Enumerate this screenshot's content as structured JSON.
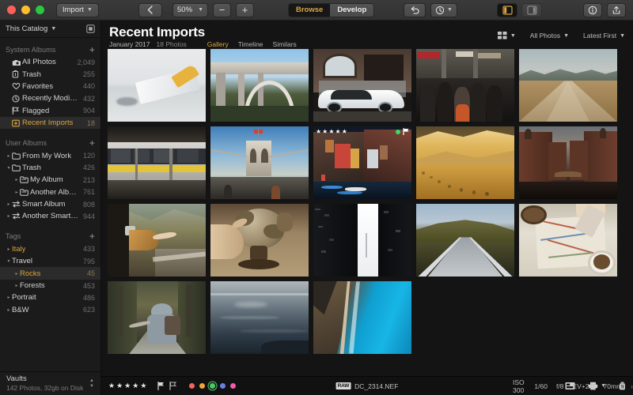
{
  "titlebar": {
    "import_label": "Import",
    "zoom_value": "50%",
    "zoom_out": "−",
    "zoom_in": "+",
    "mode_tabs": [
      {
        "label": "Browse",
        "active": true
      },
      {
        "label": "Develop",
        "active": false
      }
    ],
    "icons": {
      "back": "chevron-left-icon",
      "undo": "undo-arrow-icon",
      "history": "clock-history-icon",
      "left_panel": "left-panel-toggle-icon",
      "right_panel": "right-panel-toggle-icon",
      "info": "info-circle-icon",
      "share": "share-upload-icon"
    }
  },
  "sidebar": {
    "catalog": {
      "label": "This Catalog",
      "icon": "catalog-square-icon"
    },
    "sections": [
      {
        "title": "System Albums",
        "add": "+",
        "items": [
          {
            "label": "All Photos",
            "count": "2,049",
            "icon": "photos-stack-icon",
            "indent": 0,
            "selected": false,
            "accent": false,
            "twisty": ""
          },
          {
            "label": "Trash",
            "count": "255",
            "icon": "trash-icon",
            "indent": 0,
            "selected": false,
            "accent": false,
            "twisty": ""
          },
          {
            "label": "Favorites",
            "count": "440",
            "icon": "heart-icon",
            "indent": 0,
            "selected": false,
            "accent": false,
            "twisty": ""
          },
          {
            "label": "Recently Modified",
            "count": "432",
            "icon": "clock-icon",
            "indent": 0,
            "selected": false,
            "accent": false,
            "twisty": ""
          },
          {
            "label": "Flagged",
            "count": "904",
            "icon": "flag-icon",
            "indent": 0,
            "selected": false,
            "accent": false,
            "twisty": ""
          },
          {
            "label": "Recent Imports",
            "count": "18",
            "icon": "import-box-icon",
            "indent": 0,
            "selected": true,
            "accent": false,
            "twisty": ""
          }
        ]
      },
      {
        "title": "User Albums",
        "add": "+",
        "items": [
          {
            "label": "From My Work",
            "count": "120",
            "icon": "folder-icon",
            "indent": 0,
            "selected": false,
            "accent": false,
            "twisty": "▸"
          },
          {
            "label": "Trash",
            "count": "426",
            "icon": "folder-icon",
            "indent": 0,
            "selected": false,
            "accent": false,
            "twisty": "▾"
          },
          {
            "label": "My Album",
            "count": "213",
            "icon": "album-icon",
            "indent": 1,
            "selected": false,
            "accent": false,
            "twisty": "▸"
          },
          {
            "label": "Another Album",
            "count": "761",
            "icon": "album-icon",
            "indent": 1,
            "selected": false,
            "accent": false,
            "twisty": "▸"
          },
          {
            "label": "Smart Album",
            "count": "808",
            "icon": "smart-album-icon",
            "indent": 0,
            "selected": false,
            "accent": false,
            "twisty": "▸"
          },
          {
            "label": "Another Smart A...",
            "count": "944",
            "icon": "smart-album-icon",
            "indent": 0,
            "selected": false,
            "accent": false,
            "twisty": "▸"
          }
        ]
      },
      {
        "title": "Tags",
        "add": "+",
        "items": [
          {
            "label": "Italy",
            "count": "433",
            "icon": "",
            "indent": 0,
            "selected": false,
            "accent": true,
            "twisty": "▸"
          },
          {
            "label": "Travel",
            "count": "795",
            "icon": "",
            "indent": 0,
            "selected": false,
            "accent": false,
            "twisty": "▾"
          },
          {
            "label": "Rocks",
            "count": "45",
            "icon": "",
            "indent": 1,
            "selected": true,
            "accent": false,
            "twisty": "▸"
          },
          {
            "label": "Forests",
            "count": "453",
            "icon": "",
            "indent": 1,
            "selected": false,
            "accent": false,
            "twisty": "▸"
          },
          {
            "label": "Portrait",
            "count": "486",
            "icon": "",
            "indent": 0,
            "selected": false,
            "accent": false,
            "twisty": "▸"
          },
          {
            "label": "B&W",
            "count": "623",
            "icon": "",
            "indent": 0,
            "selected": false,
            "accent": false,
            "twisty": "▸"
          }
        ]
      }
    ],
    "vaults": {
      "title": "Vaults",
      "subtitle": "142 Photos, 32gb on Disk"
    }
  },
  "main": {
    "title": "Recent Imports",
    "date": "January 2017",
    "photo_count": "18 Photos",
    "tabs": [
      {
        "label": "Gallery",
        "active": true
      },
      {
        "label": "Timeline",
        "active": false
      },
      {
        "label": "Similars",
        "active": false
      }
    ],
    "controls": [
      {
        "label": "",
        "icon": "grid-layout-icon"
      },
      {
        "label": "All Photos",
        "icon": ""
      },
      {
        "label": "Latest First",
        "icon": ""
      }
    ]
  },
  "grid": {
    "columns": 5,
    "items": [
      {
        "name": "airplane-wing-over-clouds",
        "selected": false,
        "rating": 0,
        "flagged": false,
        "color_label": ""
      },
      {
        "name": "concrete-arch-bridge",
        "selected": false,
        "rating": 0,
        "flagged": false,
        "color_label": ""
      },
      {
        "name": "white-sports-car-street",
        "selected": false,
        "rating": 0,
        "flagged": false,
        "color_label": ""
      },
      {
        "name": "crowded-train-platform",
        "selected": false,
        "rating": 0,
        "flagged": false,
        "color_label": ""
      },
      {
        "name": "desert-road-to-mountains",
        "selected": false,
        "rating": 0,
        "flagged": false,
        "color_label": ""
      },
      {
        "name": "yellow-commuter-train",
        "selected": false,
        "rating": 0,
        "flagged": false,
        "color_label": ""
      },
      {
        "name": "brooklyn-bridge-flag",
        "selected": false,
        "rating": 0,
        "flagged": false,
        "color_label": ""
      },
      {
        "name": "cinque-terre-harbor-village",
        "selected": true,
        "rating": 5,
        "flagged": true,
        "color_label": "green"
      },
      {
        "name": "desert-dunes-footprints",
        "selected": false,
        "rating": 0,
        "flagged": false,
        "color_label": ""
      },
      {
        "name": "hamburg-warehouse-canal",
        "selected": false,
        "rating": 0,
        "flagged": false,
        "color_label": ""
      },
      {
        "name": "woman-leaning-out-car-window",
        "selected": false,
        "rating": 0,
        "flagged": false,
        "color_label": ""
      },
      {
        "name": "hand-spinning-globe",
        "selected": false,
        "rating": 0,
        "flagged": false,
        "color_label": ""
      },
      {
        "name": "skyscrapers-looking-up",
        "selected": false,
        "rating": 0,
        "flagged": false,
        "color_label": ""
      },
      {
        "name": "suspension-footbridge-forest",
        "selected": false,
        "rating": 0,
        "flagged": false,
        "color_label": ""
      },
      {
        "name": "map-coffee-planning",
        "selected": false,
        "rating": 0,
        "flagged": false,
        "color_label": ""
      },
      {
        "name": "hitchhiker-forest-road",
        "selected": false,
        "rating": 0,
        "flagged": false,
        "color_label": ""
      },
      {
        "name": "moody-ocean-horizon",
        "selected": false,
        "rating": 0,
        "flagged": false,
        "color_label": ""
      },
      {
        "name": "aerial-coastal-cliff-road",
        "selected": false,
        "rating": 0,
        "flagged": false,
        "color_label": ""
      }
    ]
  },
  "status": {
    "rating": 5,
    "star_glyph": "★",
    "flags": [
      "flag-filled-icon",
      "flag-outline-icon"
    ],
    "color_labels": [
      {
        "name": "red",
        "hex": "#f4645f",
        "active": false
      },
      {
        "name": "orange",
        "hex": "#f2a63b",
        "active": false
      },
      {
        "name": "green",
        "hex": "#4ec96a",
        "active": true
      },
      {
        "name": "blue",
        "hex": "#6c7de8",
        "active": false
      },
      {
        "name": "pink",
        "hex": "#ef5fa7",
        "active": false
      }
    ],
    "file": {
      "badge": "RAW",
      "name": "DC_2314.NEF"
    },
    "exif": [
      "ISO 300",
      "1/60",
      "f/8",
      "EV+2.0",
      "70mm"
    ],
    "exif_more": "›",
    "icons": [
      "filmstrip-icon",
      "print-icon",
      "delete-icon"
    ]
  },
  "colors": {
    "accent": "#d9a441",
    "sidebar_bg": "#1b1b1b",
    "main_bg": "#141414",
    "selection_bg": "#2b2b2b"
  }
}
